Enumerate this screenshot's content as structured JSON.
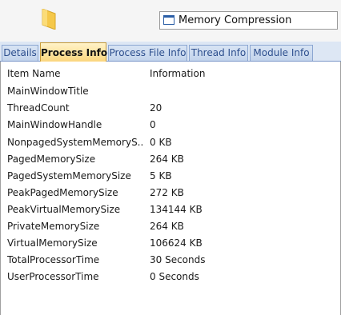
{
  "header": {
    "title_value": "Memory Compression",
    "icons": {
      "folder": "folder-icon",
      "window": "window-icon"
    }
  },
  "tabs": [
    {
      "label": "Details",
      "active": false
    },
    {
      "label": "Process Info",
      "active": true
    },
    {
      "label": "Process File Info",
      "active": false
    },
    {
      "label": "Thread Info",
      "active": false
    },
    {
      "label": "Module Info",
      "active": false
    }
  ],
  "table": {
    "columns": [
      "Item Name",
      "Information"
    ],
    "rows": [
      {
        "name": "MainWindowTitle",
        "value": ""
      },
      {
        "name": "ThreadCount",
        "value": "20"
      },
      {
        "name": "MainWindowHandle",
        "value": "0"
      },
      {
        "name": "NonpagedSystemMemoryS...",
        "value": "0 KB"
      },
      {
        "name": "PagedMemorySize",
        "value": "264 KB"
      },
      {
        "name": "PagedSystemMemorySize",
        "value": "5 KB"
      },
      {
        "name": "PeakPagedMemorySize",
        "value": "272 KB"
      },
      {
        "name": "PeakVirtualMemorySize",
        "value": "134144 KB"
      },
      {
        "name": "PrivateMemorySize",
        "value": "264 KB"
      },
      {
        "name": "VirtualMemorySize",
        "value": "106624 KB"
      },
      {
        "name": "TotalProcessorTime",
        "value": "30 Seconds"
      },
      {
        "name": "UserProcessorTime",
        "value": "0 Seconds"
      }
    ]
  },
  "colors": {
    "active_tab": "#fbd67e",
    "inactive_tab": "#c3d4ec",
    "folder": "#f5c84a"
  }
}
